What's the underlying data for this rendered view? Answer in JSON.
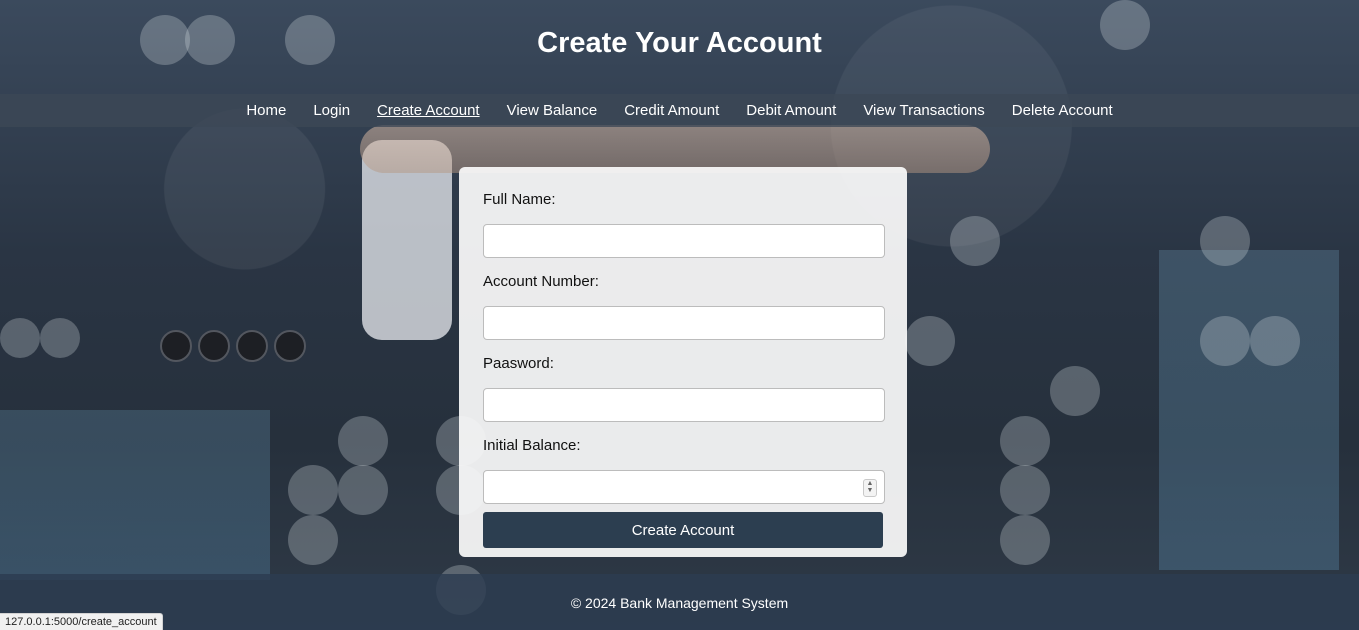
{
  "page": {
    "title": "Create Your Account"
  },
  "nav": {
    "items": [
      {
        "label": "Home"
      },
      {
        "label": "Login"
      },
      {
        "label": "Create Account",
        "active": true
      },
      {
        "label": "View Balance"
      },
      {
        "label": "Credit Amount"
      },
      {
        "label": "Debit Amount"
      },
      {
        "label": "View Transactions"
      },
      {
        "label": "Delete Account"
      }
    ]
  },
  "form": {
    "full_name_label": "Full Name:",
    "full_name_value": "",
    "account_number_label": "Account Number:",
    "account_number_value": "",
    "password_label": "Paasword:",
    "password_value": "",
    "initial_balance_label": "Initial Balance:",
    "initial_balance_value": "",
    "submit_label": "Create Account"
  },
  "footer": {
    "text": "© 2024 Bank Management System"
  },
  "status_bar": {
    "url": "127.0.0.1:5000/create_account"
  },
  "colors": {
    "nav_bar": "#3c4856",
    "button": "#2c3e50",
    "footer": "#2c3c50"
  }
}
